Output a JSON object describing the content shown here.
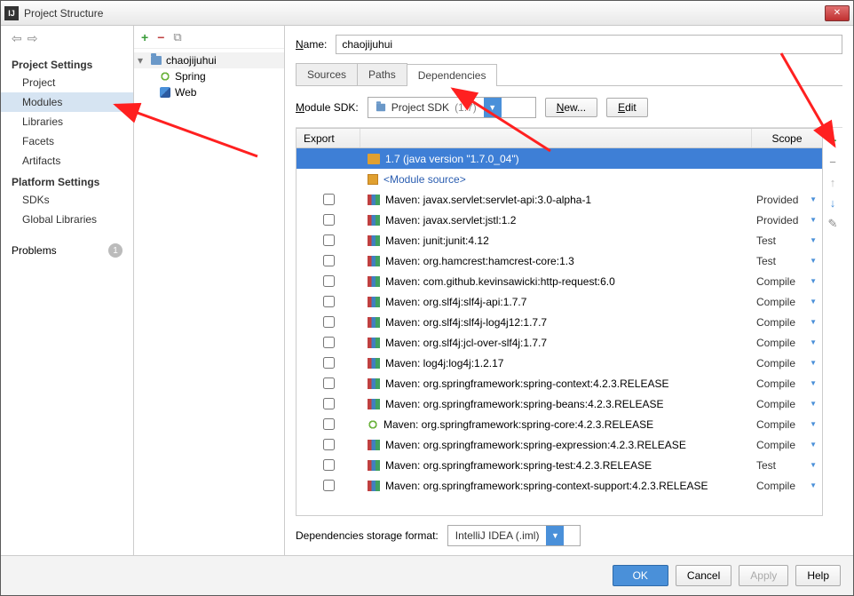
{
  "window": {
    "title": "Project Structure"
  },
  "nav": {
    "section1": "Project Settings",
    "items1": [
      "Project",
      "Modules",
      "Libraries",
      "Facets",
      "Artifacts"
    ],
    "section2": "Platform Settings",
    "items2": [
      "SDKs",
      "Global Libraries"
    ],
    "problems": "Problems",
    "problems_count": "1"
  },
  "tree": {
    "root": "chaojijuhui",
    "children": [
      "Spring",
      "Web"
    ]
  },
  "form": {
    "name_label_prefix": "N",
    "name_label_rest": "ame:",
    "name_value": "chaojijuhui"
  },
  "tabs": [
    "Sources",
    "Paths",
    "Dependencies"
  ],
  "sdk": {
    "label_prefix": "M",
    "label_rest": "odule SDK:",
    "value_main": "Project SDK",
    "value_suffix": "(1.7)",
    "new_btn_prefix": "N",
    "new_btn_rest": "ew...",
    "edit_btn_prefix": "E",
    "edit_btn_rest": "dit"
  },
  "dep_header": {
    "export": "Export",
    "scope": "Scope"
  },
  "deps": [
    {
      "type": "jdk",
      "name": "1.7 (java version \"1.7.0_04\")",
      "scope": "",
      "selected": true,
      "checkbox": false
    },
    {
      "type": "src",
      "name": "<Module source>",
      "scope": "",
      "checkbox": false,
      "link": true
    },
    {
      "type": "lib",
      "name": "Maven: javax.servlet:servlet-api:3.0-alpha-1",
      "scope": "Provided",
      "checkbox": true
    },
    {
      "type": "lib",
      "name": "Maven: javax.servlet:jstl:1.2",
      "scope": "Provided",
      "checkbox": true
    },
    {
      "type": "lib",
      "name": "Maven: junit:junit:4.12",
      "scope": "Test",
      "checkbox": true
    },
    {
      "type": "lib",
      "name": "Maven: org.hamcrest:hamcrest-core:1.3",
      "scope": "Test",
      "checkbox": true
    },
    {
      "type": "lib",
      "name": "Maven: com.github.kevinsawicki:http-request:6.0",
      "scope": "Compile",
      "checkbox": true
    },
    {
      "type": "lib",
      "name": "Maven: org.slf4j:slf4j-api:1.7.7",
      "scope": "Compile",
      "checkbox": true
    },
    {
      "type": "lib",
      "name": "Maven: org.slf4j:slf4j-log4j12:1.7.7",
      "scope": "Compile",
      "checkbox": true
    },
    {
      "type": "lib",
      "name": "Maven: org.slf4j:jcl-over-slf4j:1.7.7",
      "scope": "Compile",
      "checkbox": true
    },
    {
      "type": "lib",
      "name": "Maven: log4j:log4j:1.2.17",
      "scope": "Compile",
      "checkbox": true
    },
    {
      "type": "lib",
      "name": "Maven: org.springframework:spring-context:4.2.3.RELEASE",
      "scope": "Compile",
      "checkbox": true
    },
    {
      "type": "lib",
      "name": "Maven: org.springframework:spring-beans:4.2.3.RELEASE",
      "scope": "Compile",
      "checkbox": true
    },
    {
      "type": "spring",
      "name": "Maven: org.springframework:spring-core:4.2.3.RELEASE",
      "scope": "Compile",
      "checkbox": true
    },
    {
      "type": "lib",
      "name": "Maven: org.springframework:spring-expression:4.2.3.RELEASE",
      "scope": "Compile",
      "checkbox": true
    },
    {
      "type": "lib",
      "name": "Maven: org.springframework:spring-test:4.2.3.RELEASE",
      "scope": "Test",
      "checkbox": true
    },
    {
      "type": "lib",
      "name": "Maven: org.springframework:spring-context-support:4.2.3.RELEASE",
      "scope": "Compile",
      "checkbox": true
    }
  ],
  "storage": {
    "label": "Dependencies storage format:",
    "value": "IntelliJ IDEA (.iml)"
  },
  "footer": {
    "ok": "OK",
    "cancel": "Cancel",
    "apply": "Apply",
    "help": "Help"
  }
}
